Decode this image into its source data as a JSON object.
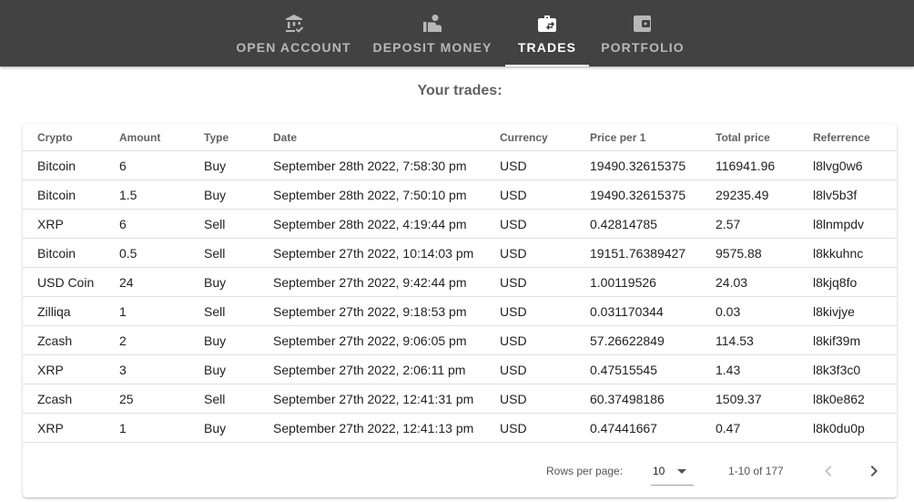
{
  "nav": {
    "tabs": [
      {
        "label": "OPEN ACCOUNT",
        "icon": "bank-icon"
      },
      {
        "label": "DEPOSIT MONEY",
        "icon": "deposit-icon"
      },
      {
        "label": "TRADES",
        "icon": "briefcase-icon"
      },
      {
        "label": "PORTFOLIO",
        "icon": "wallet-icon"
      }
    ],
    "active_tab": "TRADES"
  },
  "page": {
    "title": "Your trades:"
  },
  "table": {
    "columns": [
      "Crypto",
      "Amount",
      "Type",
      "Date",
      "Currency",
      "Price per 1",
      "Total price",
      "Referrence"
    ],
    "rows": [
      [
        "Bitcoin",
        "6",
        "Buy",
        "September 28th 2022, 7:58:30 pm",
        "USD",
        "19490.32615375",
        "116941.96",
        "l8lvg0w6"
      ],
      [
        "Bitcoin",
        "1.5",
        "Buy",
        "September 28th 2022, 7:50:10 pm",
        "USD",
        "19490.32615375",
        "29235.49",
        "l8lv5b3f"
      ],
      [
        "XRP",
        "6",
        "Sell",
        "September 28th 2022, 4:19:44 pm",
        "USD",
        "0.42814785",
        "2.57",
        "l8lnmpdv"
      ],
      [
        "Bitcoin",
        "0.5",
        "Sell",
        "September 27th 2022, 10:14:03 pm",
        "USD",
        "19151.76389427",
        "9575.88",
        "l8kkuhnc"
      ],
      [
        "USD Coin",
        "24",
        "Buy",
        "September 27th 2022, 9:42:44 pm",
        "USD",
        "1.00119526",
        "24.03",
        "l8kjq8fo"
      ],
      [
        "Zilliqa",
        "1",
        "Sell",
        "September 27th 2022, 9:18:53 pm",
        "USD",
        "0.031170344",
        "0.03",
        "l8kivjye"
      ],
      [
        "Zcash",
        "2",
        "Buy",
        "September 27th 2022, 9:06:05 pm",
        "USD",
        "57.26622849",
        "114.53",
        "l8kif39m"
      ],
      [
        "XRP",
        "3",
        "Buy",
        "September 27th 2022, 2:06:11 pm",
        "USD",
        "0.47515545",
        "1.43",
        "l8k3f3c0"
      ],
      [
        "Zcash",
        "25",
        "Sell",
        "September 27th 2022, 12:41:31 pm",
        "USD",
        "60.37498186",
        "1509.37",
        "l8k0e862"
      ],
      [
        "XRP",
        "1",
        "Buy",
        "September 27th 2022, 12:41:13 pm",
        "USD",
        "0.47441667",
        "0.47",
        "l8k0du0p"
      ]
    ]
  },
  "pagination": {
    "rows_per_page_label": "Rows per page:",
    "rows_per_page_value": "10",
    "range_text": "1-10 of 177",
    "prev_icon": "chevron-left-icon",
    "next_icon": "chevron-right-icon"
  },
  "colors": {
    "nav_background": "#424242",
    "nav_inactive_text": "#b8b8b8",
    "nav_active_text": "#ffffff",
    "title_text": "#616161",
    "row_divider": "#e0e0e0"
  }
}
